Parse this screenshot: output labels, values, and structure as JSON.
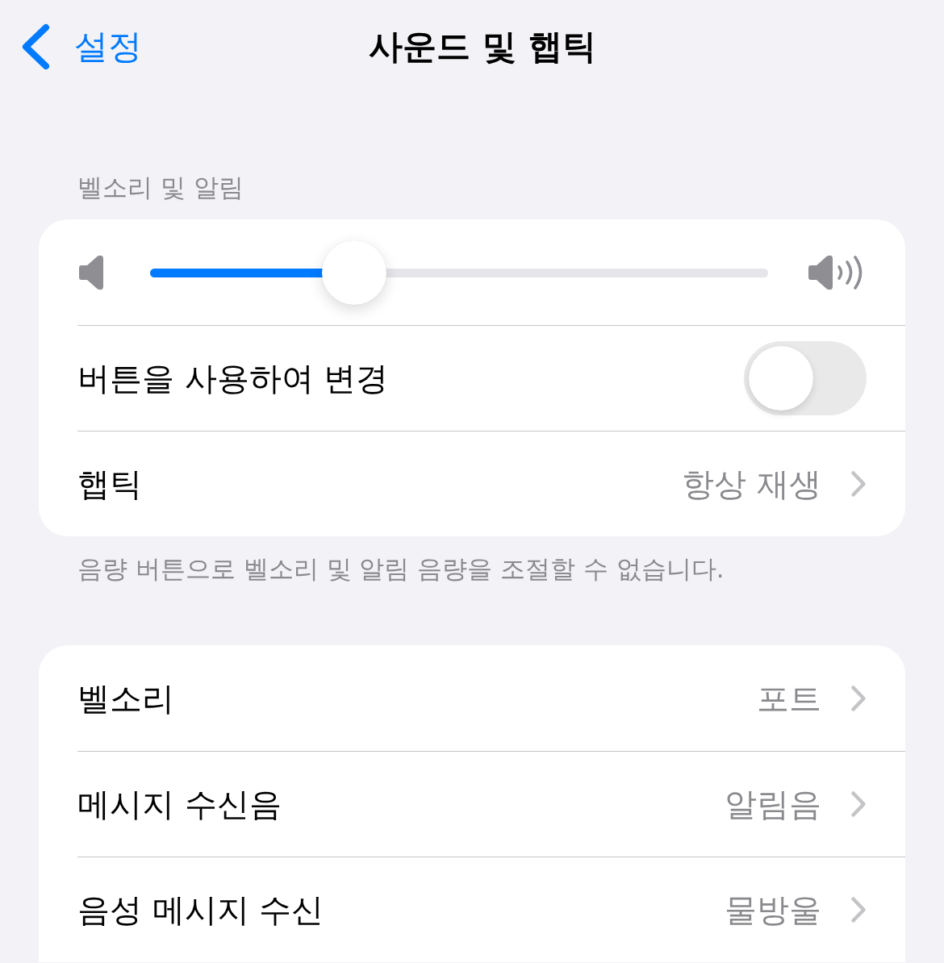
{
  "nav": {
    "back_label": "설정",
    "title": "사운드 및 햅틱"
  },
  "sections": [
    {
      "header": "벨소리 및 알림",
      "rows": [
        {
          "kind": "slider",
          "level": 0.33
        },
        {
          "kind": "toggle",
          "label": "버튼을 사용하여 변경",
          "on": false
        },
        {
          "kind": "link",
          "label": "햅틱",
          "value": "항상 재생"
        }
      ],
      "footer": "음량 버튼으로 벨소리 및 알림 음량을 조절할 수 없습니다."
    },
    {
      "rows": [
        {
          "kind": "link",
          "label": "벨소리",
          "value": "포트"
        },
        {
          "kind": "link",
          "label": "메시지 수신음",
          "value": "알림음"
        },
        {
          "kind": "link",
          "label": "음성 메시지 수신",
          "value": "물방울"
        }
      ]
    }
  ]
}
